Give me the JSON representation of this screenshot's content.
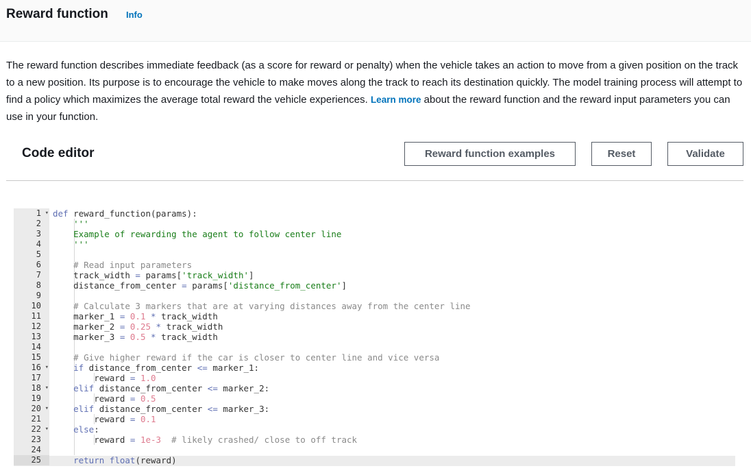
{
  "header": {
    "title": "Reward function",
    "info_link": "Info"
  },
  "description": {
    "text_before": "The reward function describes immediate feedback (as a score for reward or penalty) when the vehicle takes an action to move from a given position on the track to a new position. Its purpose is to encourage the vehicle to make moves along the track to reach its destination quickly. The model training process will attempt to find a policy which maximizes the average total reward the vehicle experiences. ",
    "link": "Learn more",
    "text_after": " about the reward function and the reward input parameters you can use in your function."
  },
  "editor": {
    "title": "Code editor",
    "buttons": {
      "examples": "Reward function examples",
      "reset": "Reset",
      "validate": "Validate"
    },
    "active_line": 25,
    "lines": [
      {
        "n": "1",
        "fold": true,
        "code": [
          [
            "kw",
            "def"
          ],
          [
            "fn",
            " reward_function(params):"
          ]
        ]
      },
      {
        "n": "2",
        "fold": false,
        "code": [
          [
            "str",
            "    '''"
          ]
        ]
      },
      {
        "n": "3",
        "fold": false,
        "code": [
          [
            "str",
            "    Example of rewarding the agent to follow center line"
          ]
        ]
      },
      {
        "n": "4",
        "fold": false,
        "code": [
          [
            "str",
            "    '''"
          ]
        ]
      },
      {
        "n": "5",
        "fold": false,
        "code": []
      },
      {
        "n": "6",
        "fold": false,
        "code": [
          [
            "cm",
            "    # Read input parameters"
          ]
        ]
      },
      {
        "n": "7",
        "fold": false,
        "code": [
          [
            "fn",
            "    track_width "
          ],
          [
            "op",
            "="
          ],
          [
            "fn",
            " params["
          ],
          [
            "str",
            "'track_width'"
          ],
          [
            "fn",
            "]"
          ]
        ]
      },
      {
        "n": "8",
        "fold": false,
        "code": [
          [
            "fn",
            "    distance_from_center "
          ],
          [
            "op",
            "="
          ],
          [
            "fn",
            " params["
          ],
          [
            "str",
            "'distance_from_center'"
          ],
          [
            "fn",
            "]"
          ]
        ]
      },
      {
        "n": "9",
        "fold": false,
        "code": []
      },
      {
        "n": "10",
        "fold": false,
        "code": [
          [
            "cm",
            "    # Calculate 3 markers that are at varying distances away from the center line"
          ]
        ]
      },
      {
        "n": "11",
        "fold": false,
        "code": [
          [
            "fn",
            "    marker_1 "
          ],
          [
            "op",
            "="
          ],
          [
            "fn",
            " "
          ],
          [
            "num-lit",
            "0.1"
          ],
          [
            "fn",
            " "
          ],
          [
            "op",
            "*"
          ],
          [
            "fn",
            " track_width"
          ]
        ]
      },
      {
        "n": "12",
        "fold": false,
        "code": [
          [
            "fn",
            "    marker_2 "
          ],
          [
            "op",
            "="
          ],
          [
            "fn",
            " "
          ],
          [
            "num-lit",
            "0.25"
          ],
          [
            "fn",
            " "
          ],
          [
            "op",
            "*"
          ],
          [
            "fn",
            " track_width"
          ]
        ]
      },
      {
        "n": "13",
        "fold": false,
        "code": [
          [
            "fn",
            "    marker_3 "
          ],
          [
            "op",
            "="
          ],
          [
            "fn",
            " "
          ],
          [
            "num-lit",
            "0.5"
          ],
          [
            "fn",
            " "
          ],
          [
            "op",
            "*"
          ],
          [
            "fn",
            " track_width"
          ]
        ]
      },
      {
        "n": "14",
        "fold": false,
        "code": []
      },
      {
        "n": "15",
        "fold": false,
        "code": [
          [
            "cm",
            "    # Give higher reward if the car is closer to center line and vice versa"
          ]
        ]
      },
      {
        "n": "16",
        "fold": true,
        "code": [
          [
            "kw",
            "    if"
          ],
          [
            "fn",
            " distance_from_center "
          ],
          [
            "op",
            "<="
          ],
          [
            "fn",
            " marker_1:"
          ]
        ]
      },
      {
        "n": "17",
        "fold": false,
        "code": [
          [
            "fn",
            "        reward "
          ],
          [
            "op",
            "="
          ],
          [
            "fn",
            " "
          ],
          [
            "num-lit",
            "1.0"
          ]
        ]
      },
      {
        "n": "18",
        "fold": true,
        "code": [
          [
            "kw",
            "    elif"
          ],
          [
            "fn",
            " distance_from_center "
          ],
          [
            "op",
            "<="
          ],
          [
            "fn",
            " marker_2:"
          ]
        ]
      },
      {
        "n": "19",
        "fold": false,
        "code": [
          [
            "fn",
            "        reward "
          ],
          [
            "op",
            "="
          ],
          [
            "fn",
            " "
          ],
          [
            "num-lit",
            "0.5"
          ]
        ]
      },
      {
        "n": "20",
        "fold": true,
        "code": [
          [
            "kw",
            "    elif"
          ],
          [
            "fn",
            " distance_from_center "
          ],
          [
            "op",
            "<="
          ],
          [
            "fn",
            " marker_3:"
          ]
        ]
      },
      {
        "n": "21",
        "fold": false,
        "code": [
          [
            "fn",
            "        reward "
          ],
          [
            "op",
            "="
          ],
          [
            "fn",
            " "
          ],
          [
            "num-lit",
            "0.1"
          ]
        ]
      },
      {
        "n": "22",
        "fold": true,
        "code": [
          [
            "kw",
            "    else"
          ],
          [
            "fn",
            ":"
          ]
        ]
      },
      {
        "n": "23",
        "fold": false,
        "code": [
          [
            "fn",
            "        reward "
          ],
          [
            "op",
            "="
          ],
          [
            "fn",
            " "
          ],
          [
            "num-lit",
            "1e-3"
          ],
          [
            "fn",
            "  "
          ],
          [
            "cm",
            "# likely crashed/ close to off track"
          ]
        ]
      },
      {
        "n": "24",
        "fold": false,
        "code": []
      },
      {
        "n": "25",
        "fold": false,
        "code": [
          [
            "kw",
            "    return"
          ],
          [
            "fn",
            " "
          ],
          [
            "kw",
            "float"
          ],
          [
            "fn",
            "(reward)"
          ]
        ]
      }
    ]
  }
}
